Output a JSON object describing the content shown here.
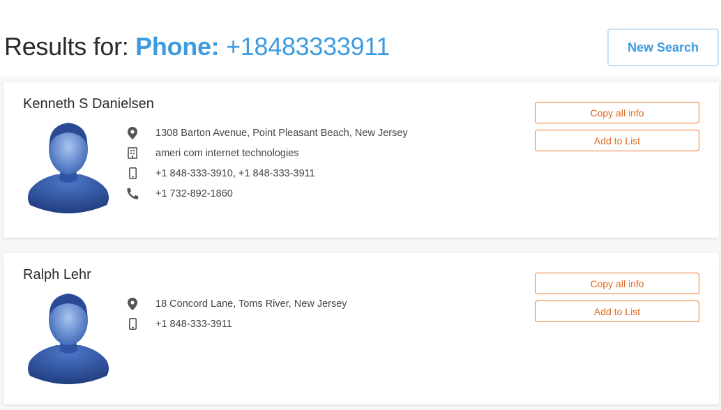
{
  "header": {
    "prefix": "Results for: ",
    "query_key": "Phone:",
    "query_value": " +18483333911",
    "new_search_label": "New Search"
  },
  "results": [
    {
      "name": "Kenneth S Danielsen",
      "address": "1308 Barton Avenue, Point Pleasant Beach, New Jersey",
      "company": "ameri com internet technologies",
      "mobile": "+1 848-333-3910,  +1 848-333-3911",
      "landline": "+1 732-892-1860",
      "copy_label": "Copy all info",
      "add_label": "Add to List"
    },
    {
      "name": "Ralph Lehr",
      "address": "18 Concord Lane, Toms River, New Jersey",
      "mobile": "+1 848-333-3911",
      "copy_label": "Copy all info",
      "add_label": "Add to List"
    }
  ],
  "icons": {
    "address": "location-pin-icon",
    "company": "building-icon",
    "mobile": "mobile-phone-icon",
    "landline": "phone-handset-icon"
  },
  "colors": {
    "accent_blue": "#3d9be0",
    "accent_orange": "#e8782f",
    "icon_gray": "#555555"
  }
}
